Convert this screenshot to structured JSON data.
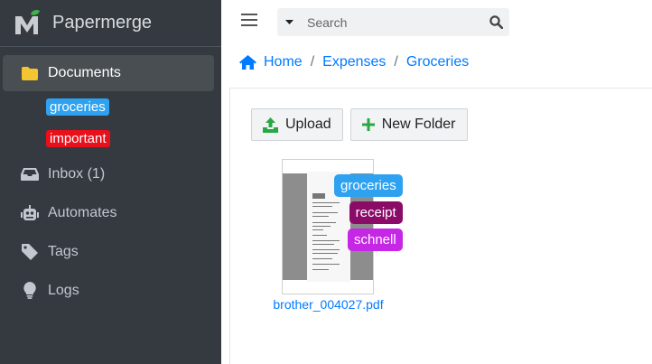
{
  "app": {
    "name": "Papermerge"
  },
  "colors": {
    "sidebar_bg": "#343a40",
    "accent": "#007bff",
    "tag_groceries": "#2ea2f0",
    "tag_important": "#e8101a",
    "tag_receipt": "#8b0b68",
    "tag_schnell": "#c626e5"
  },
  "sidebar": {
    "items": [
      {
        "label": "Documents",
        "icon": "folder-icon",
        "active": true
      },
      {
        "label": "Inbox (1)",
        "icon": "inbox-icon"
      },
      {
        "label": "Automates",
        "icon": "robot-icon"
      },
      {
        "label": "Tags",
        "icon": "tag-icon"
      },
      {
        "label": "Logs",
        "icon": "lightbulb-icon"
      }
    ],
    "tags": [
      {
        "label": "groceries"
      },
      {
        "label": "important"
      }
    ]
  },
  "search": {
    "placeholder": "Search",
    "value": ""
  },
  "breadcrumb": {
    "home": "Home",
    "items": [
      "Expenses",
      "Groceries"
    ]
  },
  "toolbar": {
    "upload_label": "Upload",
    "new_folder_label": "New Folder"
  },
  "documents": [
    {
      "title": "brother_004027.pdf",
      "tags": [
        "groceries",
        "receipt",
        "schnell"
      ]
    }
  ]
}
